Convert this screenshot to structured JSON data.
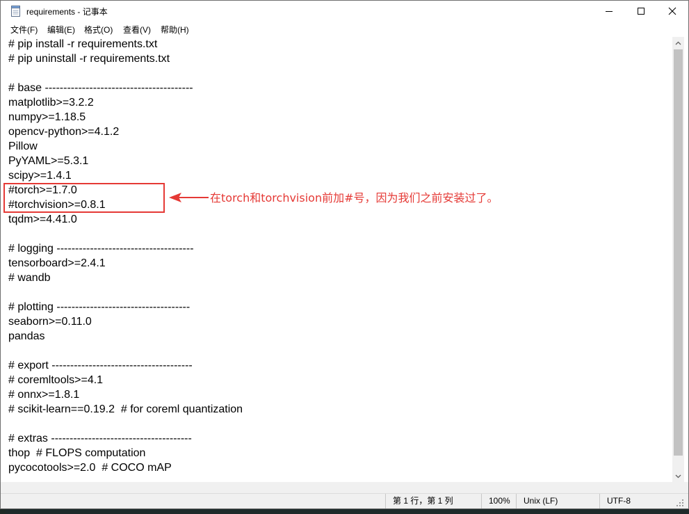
{
  "window": {
    "title": "requirements - 记事本"
  },
  "menu": [
    "文件(F)",
    "编辑(E)",
    "格式(O)",
    "查看(V)",
    "帮助(H)"
  ],
  "editor": {
    "lines": [
      "# pip install -r requirements.txt",
      "# pip uninstall -r requirements.txt",
      "",
      "# base ----------------------------------------",
      "matplotlib>=3.2.2",
      "numpy>=1.18.5",
      "opencv-python>=4.1.2",
      "Pillow",
      "PyYAML>=5.3.1",
      "scipy>=1.4.1",
      "#torch>=1.7.0",
      "#torchvision>=0.8.1",
      "tqdm>=4.41.0",
      "",
      "# logging -------------------------------------",
      "tensorboard>=2.4.1",
      "# wandb",
      "",
      "# plotting ------------------------------------",
      "seaborn>=0.11.0",
      "pandas",
      "",
      "# export --------------------------------------",
      "# coremltools>=4.1",
      "# onnx>=1.8.1",
      "# scikit-learn==0.19.2  # for coreml quantization",
      "",
      "# extras --------------------------------------",
      "thop  # FLOPS computation",
      "pycocotools>=2.0  # COCO mAP"
    ]
  },
  "annotation": {
    "text": "在torch和torchvision前加#号，因为我们之前安装过了。",
    "color": "#e53935"
  },
  "status": {
    "position": "第 1 行，第 1 列",
    "zoom": "100%",
    "line_ending": "Unix (LF)",
    "encoding": "UTF-8"
  },
  "icons": {
    "app": "notepad-icon",
    "minimize": "minimize-icon",
    "maximize": "maximize-icon",
    "close": "close-icon"
  }
}
